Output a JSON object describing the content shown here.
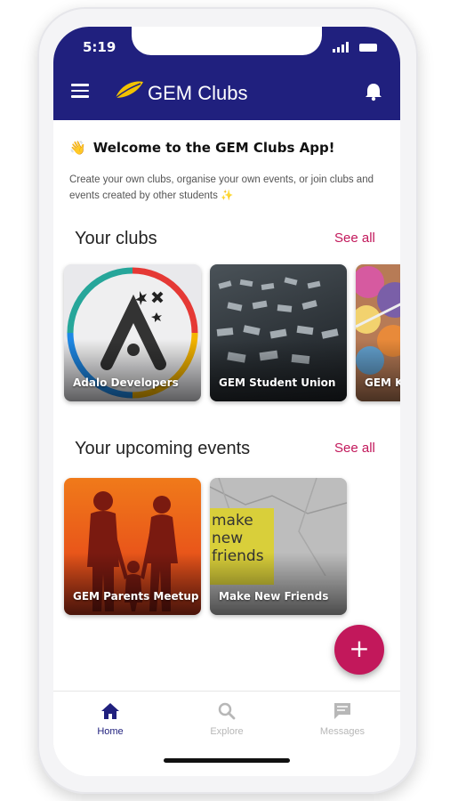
{
  "status_bar": {
    "time": "5:19"
  },
  "app_bar": {
    "title": "GEM Clubs"
  },
  "welcome": {
    "emoji": "👋",
    "title": "Welcome to the GEM Clubs App!",
    "description": "Create your own clubs, organise your own events, or join clubs and events created by other students ✨"
  },
  "clubs": {
    "title": "Your clubs",
    "see_all": "See all",
    "items": [
      {
        "label": "Adalo Developers"
      },
      {
        "label": "GEM Student Union"
      },
      {
        "label": "GEM Kn"
      }
    ]
  },
  "events": {
    "title": "Your upcoming events",
    "see_all": "See all",
    "items": [
      {
        "label": "GEM Parents Meetup"
      },
      {
        "label": "Make New Friends",
        "image_text": [
          "make",
          "new",
          "friends"
        ]
      }
    ]
  },
  "fab": {
    "label": "+"
  },
  "bottom_nav": {
    "items": [
      {
        "label": "Home",
        "icon": "home-icon",
        "active": true
      },
      {
        "label": "Explore",
        "icon": "search-icon",
        "active": false
      },
      {
        "label": "Messages",
        "icon": "chat-icon",
        "active": false
      }
    ]
  },
  "colors": {
    "primary": "#20207e",
    "accent": "#c2185b",
    "inactive": "#b7b7b7"
  }
}
